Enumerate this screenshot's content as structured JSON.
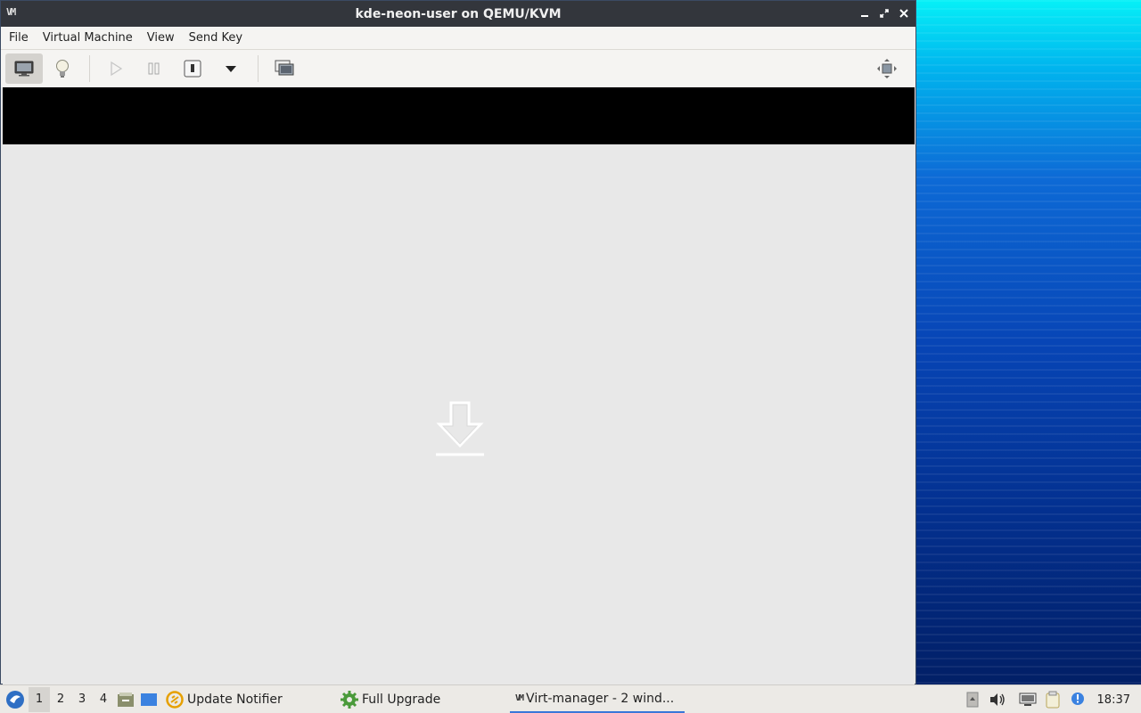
{
  "window": {
    "title": "kde-neon-user on QEMU/KVM",
    "app_icon_text": "VM"
  },
  "menubar": {
    "items": [
      {
        "label": "File"
      },
      {
        "label": "Virtual Machine"
      },
      {
        "label": "View"
      },
      {
        "label": "Send Key"
      }
    ]
  },
  "toolbar": {
    "buttons": [
      {
        "icon": "console-icon",
        "active": true
      },
      {
        "icon": "details-lightbulb-icon",
        "active": false
      },
      {
        "icon": "run-icon",
        "active": false
      },
      {
        "icon": "pause-icon",
        "active": false
      },
      {
        "icon": "shutdown-icon",
        "active": false
      },
      {
        "icon": "shutdown-menu-icon",
        "active": false
      },
      {
        "icon": "snapshots-icon",
        "active": false
      }
    ],
    "fullscreen_icon": "fullscreen-icon"
  },
  "taskbar": {
    "workspaces": [
      "1",
      "2",
      "3",
      "4"
    ],
    "active_workspace": "1",
    "tasks": [
      {
        "label": "Update Notifier",
        "icon": "update-notifier-icon"
      },
      {
        "label": "Full Upgrade",
        "icon": "gear-icon"
      },
      {
        "label": "Virt-manager - 2 wind...",
        "icon": "virt-manager-icon",
        "active": true
      }
    ],
    "clock": "18:37"
  },
  "colors": {
    "titlebar": "#33363c",
    "accent": "#3a77d8"
  }
}
